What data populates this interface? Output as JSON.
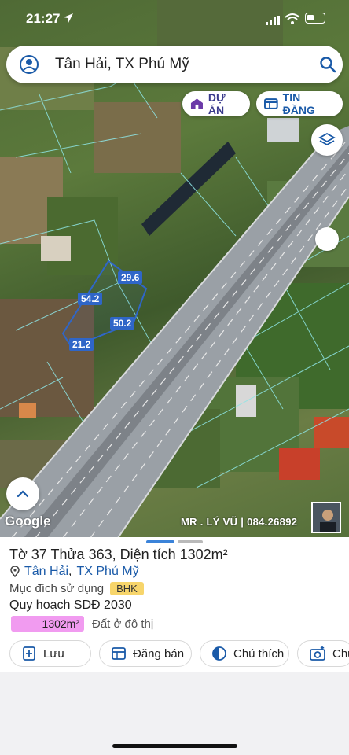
{
  "status": {
    "time": "21:27"
  },
  "search": {
    "text": "Tân Hải, TX Phú Mỹ"
  },
  "chips": {
    "du_an": "DỰ ÁN",
    "tin_dang": "TIN ĐĂNG"
  },
  "map": {
    "google": "Google",
    "watermark": "MR . LÝ VŨ | 084.26892",
    "measurements": {
      "top": "29.6",
      "left": "54.2",
      "right": "50.2",
      "bottom": "21.2"
    }
  },
  "sheet": {
    "title": "Tờ 37 Thửa 363, Diện tích 1302m²",
    "address_commune": "Tân Hải",
    "address_sep": ",",
    "address_town": "TX Phú Mỹ",
    "purpose_label": "Mục đích sử dụng",
    "purpose_code": "BHK",
    "plan_label": "Quy hoạch SDĐ 2030",
    "plan_area": "1302m²",
    "plan_type": "Đất ở đô thị",
    "actions": {
      "save": "Lưu",
      "post": "Đăng bán",
      "legend": "Chú thích",
      "photo": "Chụ"
    }
  },
  "colors": {
    "accent": "#1a5aa8",
    "plot_outline": "#2f66c8",
    "plan_badge": "#f19bf0",
    "bhk_badge": "#f7d56b"
  }
}
